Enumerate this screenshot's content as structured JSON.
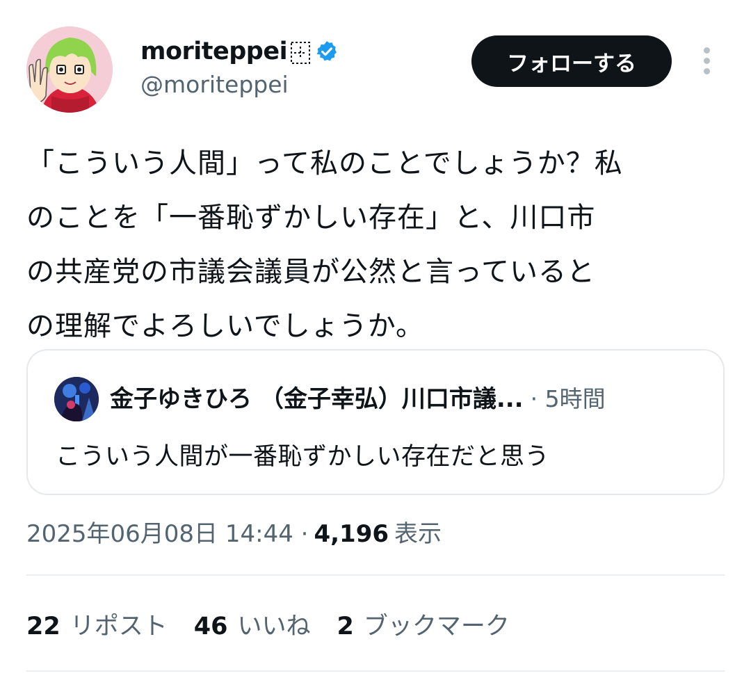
{
  "author": {
    "display_name": "moriteppei",
    "handle": "@moriteppei",
    "verified": true,
    "avatar_icon": "anime-avatar-icon"
  },
  "actions": {
    "follow_label": "フォローする",
    "more_icon": "more-options-icon"
  },
  "tweet": {
    "text": "「こういう人間」って私のことでしょうか？私\nのことを「一番恥ずかしい存在」と、川口市\nの共産党の市議会議員が公然と言っていると\nの理解でよろしいでしょうか。"
  },
  "quote": {
    "author": "金子ゆきひろ （金子幸弘）川口市議...",
    "time": "· 5時間",
    "text": "こういう人間が一番恥ずかしい存在だと思う"
  },
  "meta": {
    "timestamp": "2025年06月08日 14:44 ·",
    "views_count": "4,196",
    "views_label": "表示"
  },
  "stats": {
    "reposts_count": "22",
    "reposts_label": "リポスト",
    "likes_count": "46",
    "likes_label": "いいね",
    "bookmarks_count": "2",
    "bookmarks_label": "ブックマーク"
  },
  "colors": {
    "text_primary": "#0f1419",
    "text_secondary": "#536471",
    "verified_blue": "#1d9bf0",
    "border": "#e6e9ec"
  }
}
